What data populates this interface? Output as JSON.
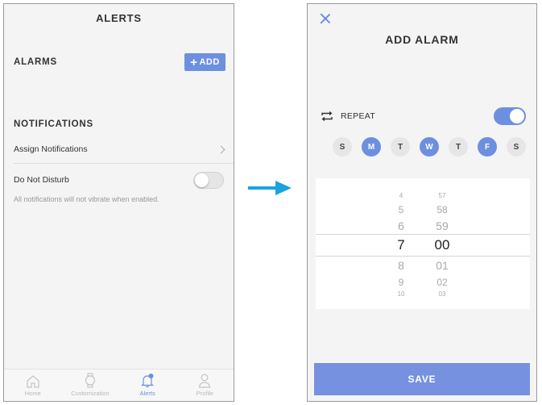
{
  "left": {
    "header_title": "ALERTS",
    "alarms_label": "ALARMS",
    "add_label": "ADD",
    "notifications_label": "NOTIFICATIONS",
    "assign_label": "Assign Notifications",
    "dnd_label": "Do Not Disturb",
    "dnd_enabled": false,
    "dnd_hint": "All notifications will not vibrate when enabled.",
    "tabs": [
      {
        "label": "Home",
        "icon": "home-icon",
        "active": false
      },
      {
        "label": "Customization",
        "icon": "watch-icon",
        "active": false
      },
      {
        "label": "Alerts",
        "icon": "bell-icon",
        "active": true
      },
      {
        "label": "Profile",
        "icon": "person-icon",
        "active": false
      }
    ]
  },
  "right": {
    "title": "ADD ALARM",
    "repeat_label": "REPEAT",
    "repeat_enabled": true,
    "days": [
      {
        "label": "S",
        "on": false
      },
      {
        "label": "M",
        "on": true
      },
      {
        "label": "T",
        "on": false
      },
      {
        "label": "W",
        "on": true
      },
      {
        "label": "T",
        "on": false
      },
      {
        "label": "F",
        "on": true
      },
      {
        "label": "S",
        "on": false
      }
    ],
    "hours": [
      "4",
      "5",
      "6",
      "7",
      "8",
      "9",
      "10"
    ],
    "minutes": [
      "57",
      "58",
      "59",
      "00",
      "01",
      "02",
      "03"
    ],
    "selected_hour": "7",
    "selected_minute": "00",
    "save_label": "SAVE"
  },
  "colors": {
    "accent": "#6d8fe0",
    "arrow": "#1aa3dc"
  }
}
